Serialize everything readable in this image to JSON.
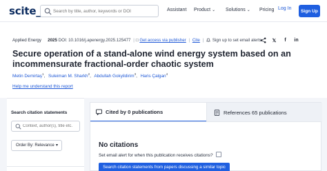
{
  "nav": {
    "logo": "scite_",
    "search_placeholder": "Search by title, author, keywords or DOI",
    "links": [
      {
        "label": "Assistant",
        "has_dropdown": false
      },
      {
        "label": "Product",
        "has_dropdown": true
      },
      {
        "label": "Solutions",
        "has_dropdown": true
      },
      {
        "label": "Pricing",
        "has_dropdown": false
      }
    ],
    "login": "Log In",
    "signup": "Sign Up"
  },
  "article": {
    "journal": "Applied Energy",
    "year": "2025",
    "doi": "DOI: 10.1016/j.apenergy.2025.125477",
    "access_link": "Get access via publisher",
    "cite": "Cite",
    "alert_link": "Sign up to set email alerts",
    "title": "Secure operation of a stand-alone wind energy system based on an incommensurate fractional-order chaotic system",
    "authors": [
      {
        "name": "Metin Demirtaş",
        "sup": "1"
      },
      {
        "name": "Suleiman M. Sharkh",
        "sup": "2"
      },
      {
        "name": "Abdullah Gokyildirim",
        "sup": "3"
      },
      {
        "name": "Haris Çalgan",
        "sup": "4"
      }
    ],
    "help_link": "Help me understand this report"
  },
  "filters": {
    "header": "Search citation statements",
    "context_placeholder": "Context, author(s), title etc.",
    "order_label": "Order By: Relevance"
  },
  "tabs": {
    "cited_prefix": "Cited by",
    "cited_count": "0",
    "cited_suffix": "publications",
    "refs_prefix": "References",
    "refs_count": "65",
    "refs_suffix": "publications"
  },
  "results": {
    "no_citations": "No citations",
    "email_alert": "Set email alert for when this publication receives citations?",
    "cta": "Search citation statements from papers discussing a similar topic"
  },
  "colors": {
    "accent": "#1f5fe0",
    "link": "#1e58d6",
    "brand": "#0a2a5e"
  }
}
